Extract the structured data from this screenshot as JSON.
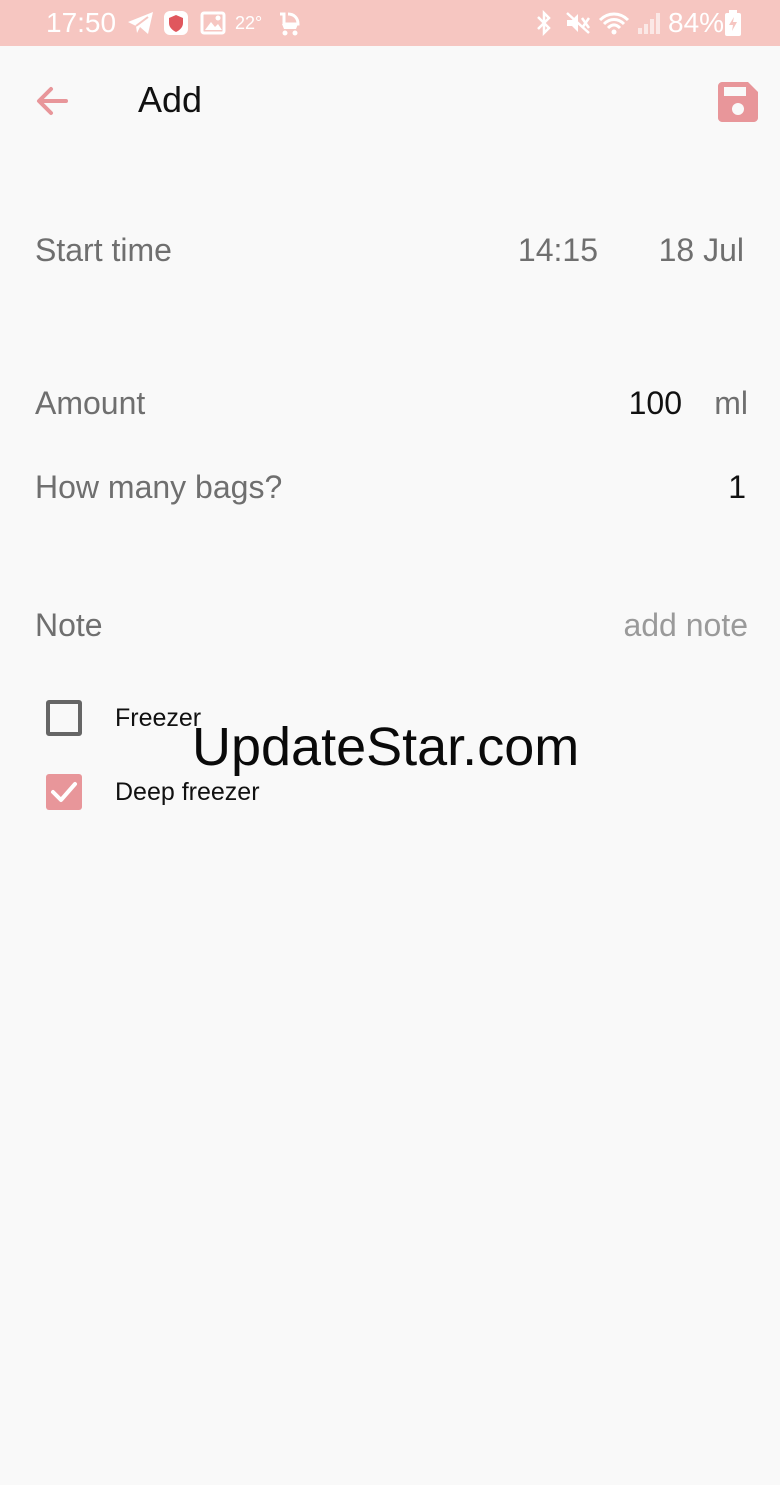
{
  "status_bar": {
    "time": "17:50",
    "temperature": "22°",
    "battery_percent": "84%",
    "icons": [
      "telegram-icon",
      "shield-icon",
      "image-icon",
      "stroller-icon",
      "bluetooth-icon",
      "mute-icon",
      "wifi-icon",
      "signal-icon",
      "battery-charging-icon"
    ]
  },
  "toolbar": {
    "title": "Add",
    "back_icon": "arrow-left-icon",
    "save_icon": "floppy-save-icon"
  },
  "form": {
    "start_time": {
      "label": "Start time",
      "time": "14:15",
      "date": "18 Jul"
    },
    "amount": {
      "label": "Amount",
      "value": "100",
      "unit": "ml"
    },
    "bags": {
      "label": "How many bags?",
      "value": "1"
    },
    "note": {
      "label": "Note",
      "placeholder": "add note"
    },
    "storage": [
      {
        "label": "Freezer",
        "checked": false
      },
      {
        "label": "Deep freezer",
        "checked": true
      }
    ]
  },
  "watermark": "UpdateStar.com",
  "colors": {
    "accent": "#e8969a",
    "status_bar": "#f6c6c1",
    "background": "#f9f9f9"
  }
}
